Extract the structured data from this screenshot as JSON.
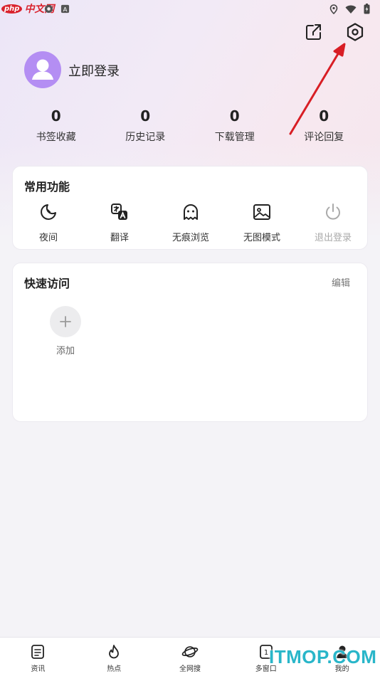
{
  "watermarks": {
    "top_left_badge": "php",
    "top_left_text": "中文网",
    "bottom_right": "ITMOP.COM"
  },
  "profile": {
    "login_label": "立即登录"
  },
  "stats": [
    {
      "value": "0",
      "label": "书签收藏"
    },
    {
      "value": "0",
      "label": "历史记录"
    },
    {
      "value": "0",
      "label": "下载管理"
    },
    {
      "value": "0",
      "label": "评论回复"
    }
  ],
  "common_functions": {
    "title": "常用功能",
    "items": [
      {
        "label": "夜间",
        "icon": "moon-icon"
      },
      {
        "label": "翻译",
        "icon": "translate-icon"
      },
      {
        "label": "无痕浏览",
        "icon": "ghost-icon"
      },
      {
        "label": "无图模式",
        "icon": "no-image-icon"
      },
      {
        "label": "退出登录",
        "icon": "power-icon",
        "disabled": true
      }
    ]
  },
  "quick_access": {
    "title": "快速访问",
    "edit_label": "编辑",
    "add_label": "添加"
  },
  "bottom_nav": [
    {
      "label": "资讯",
      "icon": "news-icon"
    },
    {
      "label": "热点",
      "icon": "flame-icon"
    },
    {
      "label": "全网搜",
      "icon": "planet-icon"
    },
    {
      "label": "多窗口",
      "icon": "windows-icon",
      "badge": "1"
    },
    {
      "label": "我的",
      "icon": "user-icon"
    }
  ],
  "colors": {
    "accent": "#b48ef3",
    "annotation_arrow": "#d81e25",
    "watermark_teal": "#29b6c9"
  }
}
